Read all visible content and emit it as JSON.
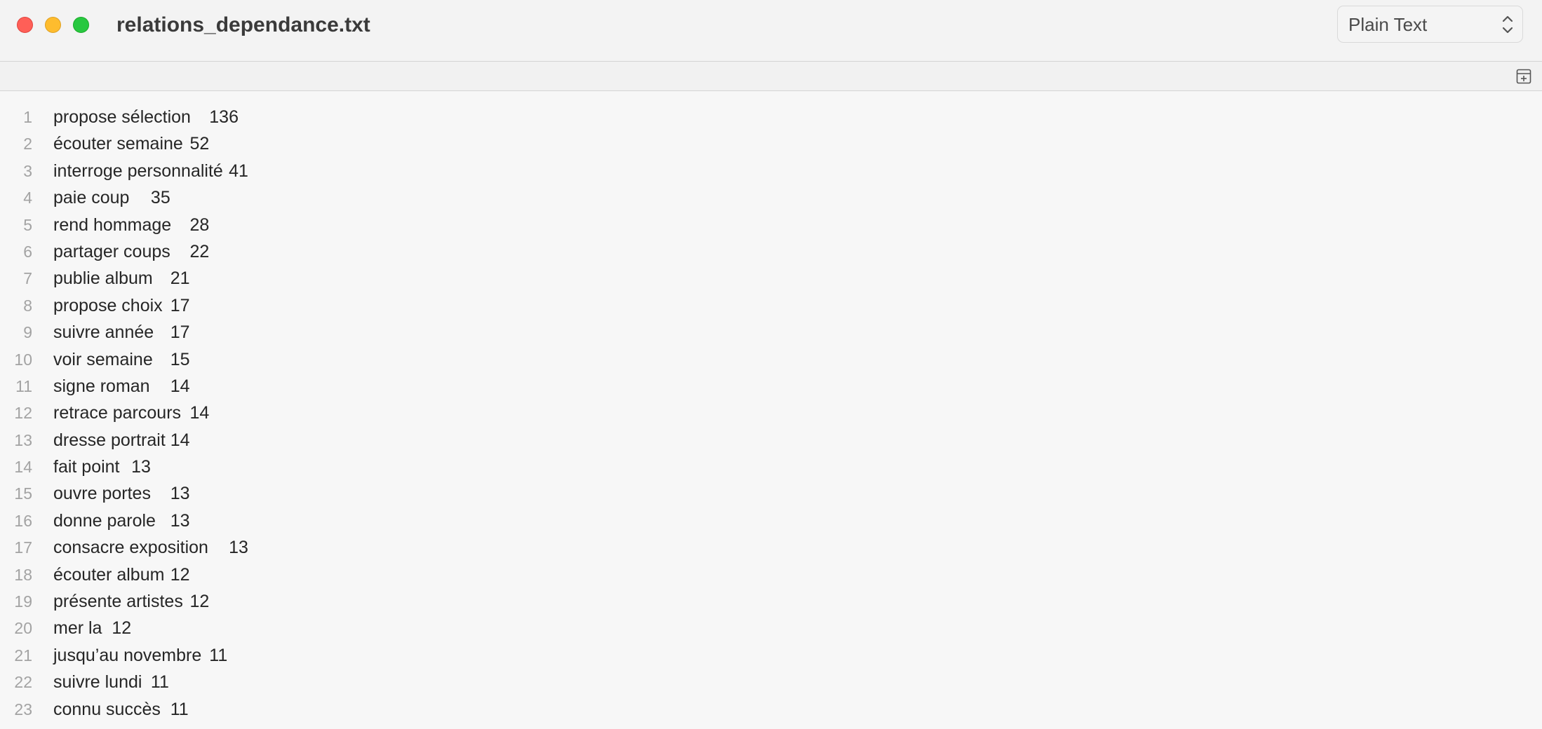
{
  "window": {
    "title": "relations_dependance.txt"
  },
  "format_select": {
    "value": "Plain Text"
  },
  "icons": {
    "close": "close-button",
    "minimize": "minimize-button",
    "zoom": "zoom-button",
    "chevron": "chevron-up-down-icon",
    "strip": "add-section-icon"
  },
  "colors": {
    "close": "#ff5f57",
    "minimize": "#febc2e",
    "zoom": "#28c840"
  },
  "lines": [
    {
      "n": "1",
      "text": "propose sélection\t136"
    },
    {
      "n": "2",
      "text": "écouter semaine\t52"
    },
    {
      "n": "3",
      "text": "interroge personnalité\t41"
    },
    {
      "n": "4",
      "text": "paie coup\t35"
    },
    {
      "n": "5",
      "text": "rend hommage\t28"
    },
    {
      "n": "6",
      "text": "partager coups\t22"
    },
    {
      "n": "7",
      "text": "publie album\t21"
    },
    {
      "n": "8",
      "text": "propose choix\t17"
    },
    {
      "n": "9",
      "text": "suivre année\t17"
    },
    {
      "n": "10",
      "text": "voir semaine\t15"
    },
    {
      "n": "11",
      "text": "signe roman\t14"
    },
    {
      "n": "12",
      "text": "retrace parcours\t14"
    },
    {
      "n": "13",
      "text": "dresse portrait\t14"
    },
    {
      "n": "14",
      "text": "fait point\t13"
    },
    {
      "n": "15",
      "text": "ouvre portes\t13"
    },
    {
      "n": "16",
      "text": "donne parole\t13"
    },
    {
      "n": "17",
      "text": "consacre exposition\t13"
    },
    {
      "n": "18",
      "text": "écouter album\t12"
    },
    {
      "n": "19",
      "text": "présente artistes\t12"
    },
    {
      "n": "20",
      "text": "mer la\t12"
    },
    {
      "n": "21",
      "text": "jusqu’au novembre\t11"
    },
    {
      "n": "22",
      "text": "suivre lundi\t11"
    },
    {
      "n": "23",
      "text": "connu succès\t11"
    }
  ]
}
